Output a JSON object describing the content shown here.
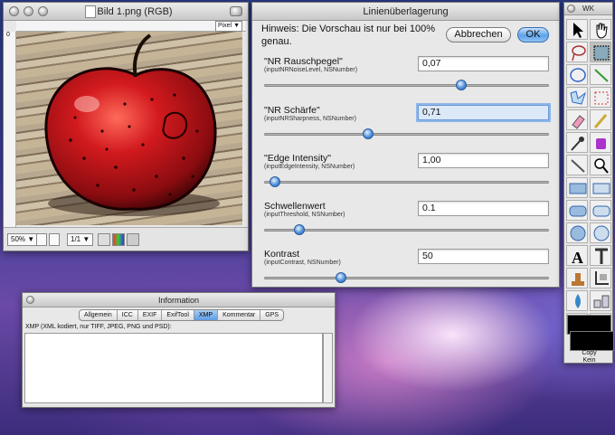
{
  "image_window": {
    "title": "Bild 1.png (RGB)",
    "unit_select": "Pixel",
    "ruler_zero": "0",
    "zoom": "50%",
    "page": "1/1"
  },
  "dialog": {
    "title": "Linienüberlagerung",
    "hint": "Hinweis: Die Vorschau ist nur bei 100% genau.",
    "cancel_label": "Abbrechen",
    "ok_label": "OK",
    "params": [
      {
        "label": "\"NR Rauschpegel\"",
        "sub": "(inputNRNoiseLevel, NSNumber)",
        "value": "0,07",
        "slider": 0.7
      },
      {
        "label": "\"NR Schärfe\"",
        "sub": "(inputNRSharpness, NSNumber)",
        "value": "0,71",
        "slider": 0.36,
        "focused": true
      },
      {
        "label": "\"Edge Intensity\"",
        "sub": "(inputEdgeIntensity, NSNumber)",
        "value": "1,00",
        "slider": 0.02
      },
      {
        "label": "Schwellenwert",
        "sub": "(inputThreshold, NSNumber)",
        "value": "0.1",
        "slider": 0.11
      },
      {
        "label": "Kontrast",
        "sub": "(inputContrast, NSNumber)",
        "value": "50",
        "slider": 0.26
      }
    ]
  },
  "tools": {
    "title": "WK",
    "copy_label": "Copy",
    "none_label": "Kein",
    "colors": {
      "foreground": "#000000",
      "background": "#000000"
    }
  },
  "info_window": {
    "title": "Information",
    "tabs": [
      "Allgemein",
      "ICC",
      "EXIF",
      "ExifTool",
      "XMP",
      "Kommentar",
      "GPS"
    ],
    "active_tab": "XMP",
    "xmp_note": "XMP (XML kodiert, nur TIFF, JPEG, PNG und PSD):"
  },
  "colors": {
    "accent": "#5ea2e9",
    "apple_red": "#c8161c"
  }
}
